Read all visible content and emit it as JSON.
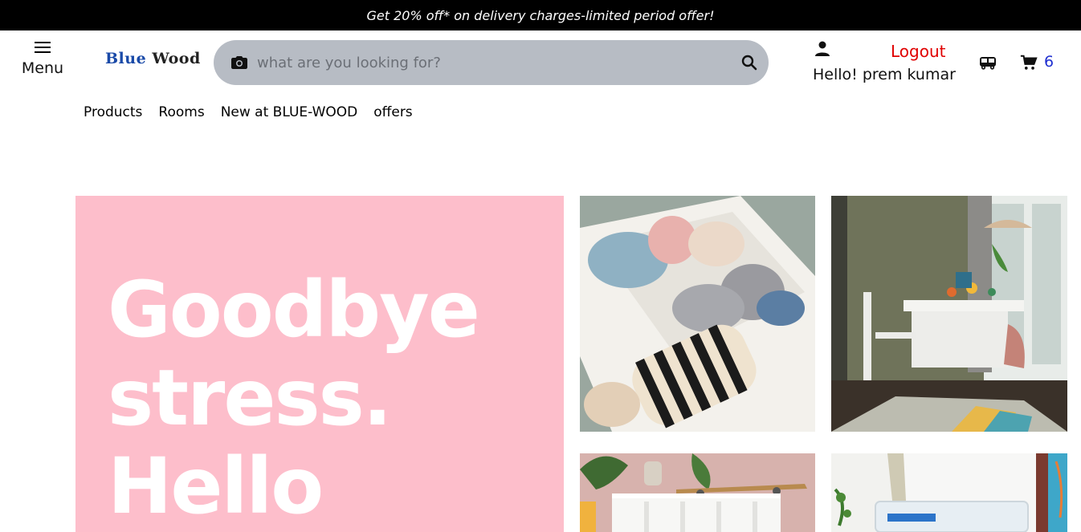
{
  "promo": {
    "text": "Get 20% off* on delivery charges-limited period offer!"
  },
  "header": {
    "menu_label": "Menu",
    "logo_blue": "Blue",
    "logo_dark": "Wood",
    "search_placeholder": "what are you looking for?",
    "logout_label": "Logout",
    "greeting": "Hello! prem kumar",
    "cart_count": "6"
  },
  "nav": {
    "items": [
      {
        "label": "Products"
      },
      {
        "label": "Rooms"
      },
      {
        "label": "New at BLUE-WOOD"
      },
      {
        "label": "offers"
      }
    ]
  },
  "hero": {
    "line1": "Goodbye",
    "line2": "stress.",
    "line3": "Hello"
  },
  "colors": {
    "promo_bg": "#000000",
    "search_bg": "#b7bcc4",
    "logout": "#e00000",
    "cart_count": "#1f2fd0",
    "hero_bg": "#fdbecb",
    "logo_blue": "#1a4aa8"
  },
  "tiles": [
    {
      "icon": "folded-clothes-drawer-photo"
    },
    {
      "icon": "dining-room-table-photo"
    },
    {
      "icon": "shelf-with-plants-photo"
    },
    {
      "icon": "clear-storage-box-photo"
    }
  ]
}
